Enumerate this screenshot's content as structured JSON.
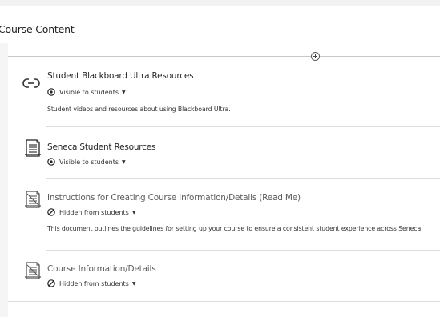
{
  "page": {
    "title": "Course Content"
  },
  "items": [
    {
      "icon": "link-icon",
      "title": "Student Blackboard Ultra Resources",
      "visibility": "Visible to students",
      "description": "Student videos and resources about using Blackboard Ultra."
    },
    {
      "icon": "document-icon",
      "title": "Seneca Student Resources",
      "visibility": "Visible to students"
    },
    {
      "icon": "document-hidden-icon",
      "title": "Instructions for Creating Course Information/Details (Read Me)",
      "visibility": "Hidden from students",
      "description": "This document outlines the guidelines for setting up your course to ensure a consistent student experience across Seneca."
    },
    {
      "icon": "document-hidden-icon",
      "title": "Course Information/Details",
      "visibility": "Hidden from students"
    }
  ],
  "colors": {
    "text": "#262626",
    "hidden_text": "#5c5c5c",
    "divider": "#dcdcdc"
  }
}
